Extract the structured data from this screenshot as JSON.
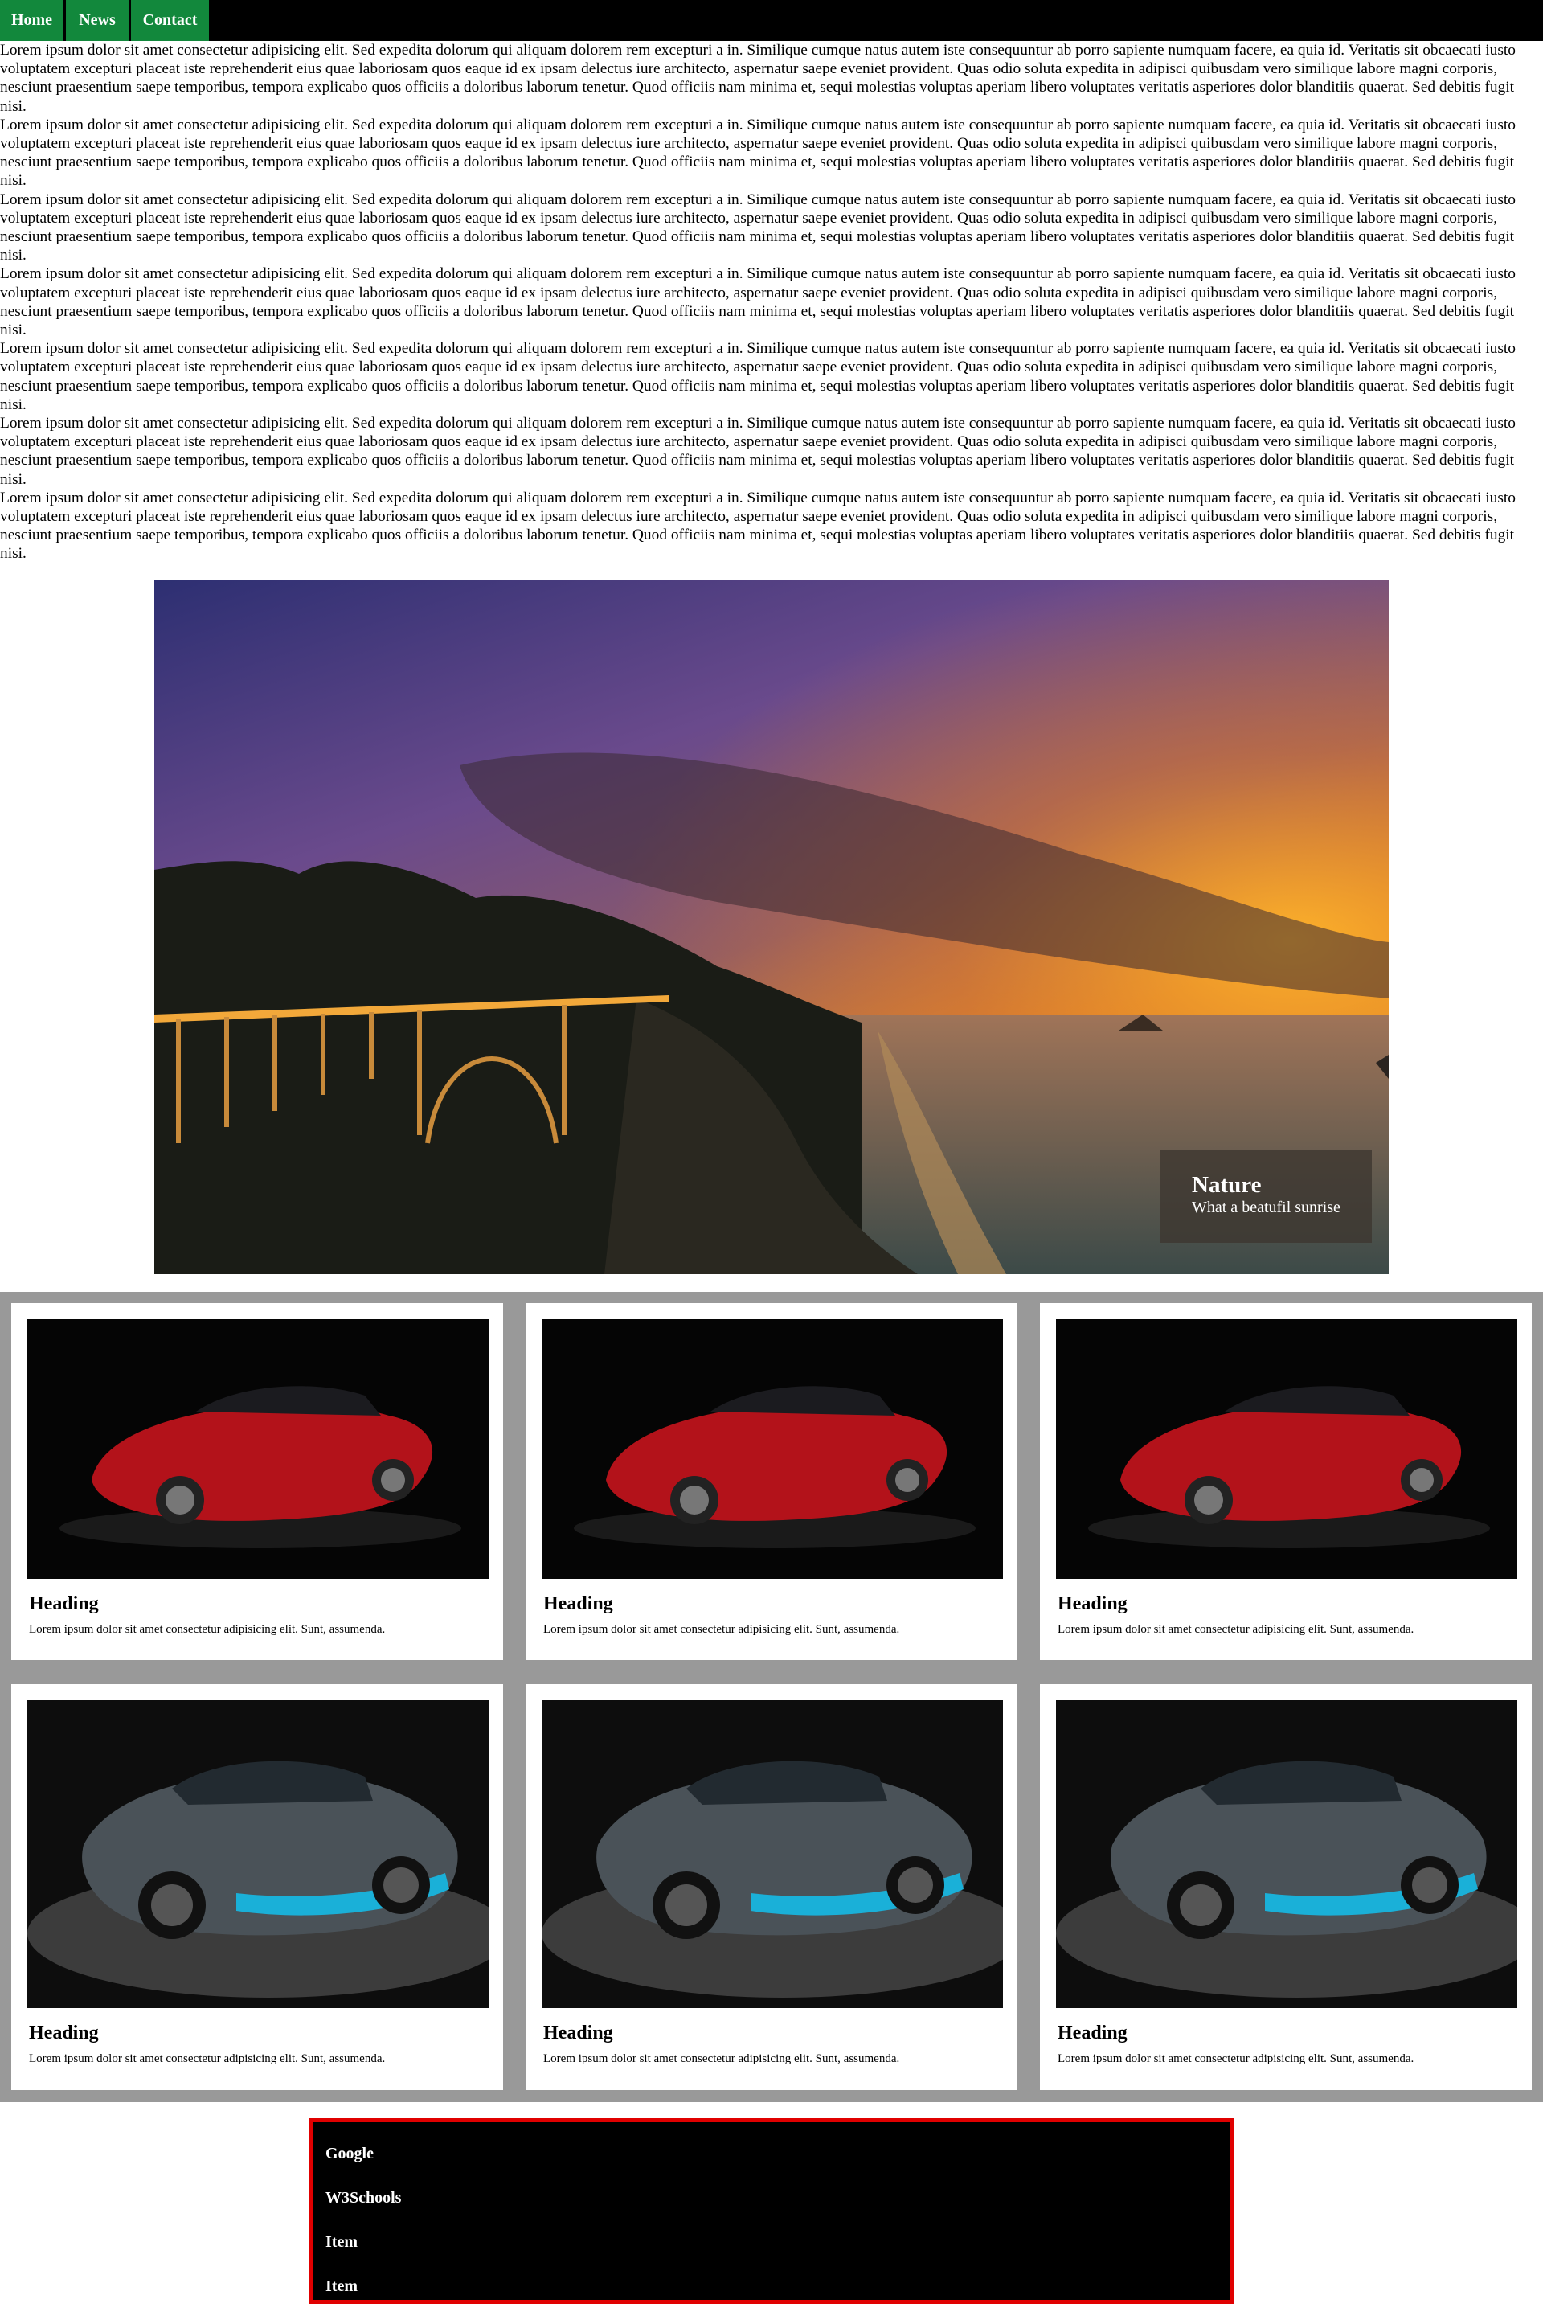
{
  "nav": {
    "items": [
      "Home",
      "News",
      "Contact"
    ],
    "background": "#000000",
    "item_color": "#12883c"
  },
  "lorem": {
    "paragraphs": [
      "Lorem ipsum dolor sit amet consectetur adipisicing elit. Sed expedita dolorum qui aliquam dolorem rem excepturi a in. Similique cumque natus autem iste consequuntur ab porro sapiente numquam facere, ea quia id. Veritatis sit obcaecati iusto voluptatem excepturi placeat iste reprehenderit eius quae laboriosam quos eaque id ex ipsam delectus iure architecto, aspernatur saepe eveniet provident. Quas odio soluta expedita in adipisci quibusdam vero similique labore magni corporis, nesciunt praesentium saepe temporibus, tempora explicabo quos officiis a doloribus laborum tenetur. Quod officiis nam minima et, sequi molestias voluptas aperiam libero voluptates veritatis asperiores dolor blanditiis quaerat. Sed debitis fugit nisi.",
      "Lorem ipsum dolor sit amet consectetur adipisicing elit. Sed expedita dolorum qui aliquam dolorem rem excepturi a in. Similique cumque natus autem iste consequuntur ab porro sapiente numquam facere, ea quia id. Veritatis sit obcaecati iusto voluptatem excepturi placeat iste reprehenderit eius quae laboriosam quos eaque id ex ipsam delectus iure architecto, aspernatur saepe eveniet provident. Quas odio soluta expedita in adipisci quibusdam vero similique labore magni corporis, nesciunt praesentium saepe temporibus, tempora explicabo quos officiis a doloribus laborum tenetur. Quod officiis nam minima et, sequi molestias voluptas aperiam libero voluptates veritatis asperiores dolor blanditiis quaerat. Sed debitis fugit nisi.",
      "Lorem ipsum dolor sit amet consectetur adipisicing elit. Sed expedita dolorum qui aliquam dolorem rem excepturi a in. Similique cumque natus autem iste consequuntur ab porro sapiente numquam facere, ea quia id. Veritatis sit obcaecati iusto voluptatem excepturi placeat iste reprehenderit eius quae laboriosam quos eaque id ex ipsam delectus iure architecto, aspernatur saepe eveniet provident. Quas odio soluta expedita in adipisci quibusdam vero similique labore magni corporis, nesciunt praesentium saepe temporibus, tempora explicabo quos officiis a doloribus laborum tenetur. Quod officiis nam minima et, sequi molestias voluptas aperiam libero voluptates veritatis asperiores dolor blanditiis quaerat. Sed debitis fugit nisi.",
      "Lorem ipsum dolor sit amet consectetur adipisicing elit. Sed expedita dolorum qui aliquam dolorem rem excepturi a in. Similique cumque natus autem iste consequuntur ab porro sapiente numquam facere, ea quia id. Veritatis sit obcaecati iusto voluptatem excepturi placeat iste reprehenderit eius quae laboriosam quos eaque id ex ipsam delectus iure architecto, aspernatur saepe eveniet provident. Quas odio soluta expedita in adipisci quibusdam vero similique labore magni corporis, nesciunt praesentium saepe temporibus, tempora explicabo quos officiis a doloribus laborum tenetur. Quod officiis nam minima et, sequi molestias voluptas aperiam libero voluptates veritatis asperiores dolor blanditiis quaerat. Sed debitis fugit nisi.",
      "Lorem ipsum dolor sit amet consectetur adipisicing elit. Sed expedita dolorum qui aliquam dolorem rem excepturi a in. Similique cumque natus autem iste consequuntur ab porro sapiente numquam facere, ea quia id. Veritatis sit obcaecati iusto voluptatem excepturi placeat iste reprehenderit eius quae laboriosam quos eaque id ex ipsam delectus iure architecto, aspernatur saepe eveniet provident. Quas odio soluta expedita in adipisci quibusdam vero similique labore magni corporis, nesciunt praesentium saepe temporibus, tempora explicabo quos officiis a doloribus laborum tenetur. Quod officiis nam minima et, sequi molestias voluptas aperiam libero voluptates veritatis asperiores dolor blanditiis quaerat. Sed debitis fugit nisi.",
      "Lorem ipsum dolor sit amet consectetur adipisicing elit. Sed expedita dolorum qui aliquam dolorem rem excepturi a in. Similique cumque natus autem iste consequuntur ab porro sapiente numquam facere, ea quia id. Veritatis sit obcaecati iusto voluptatem excepturi placeat iste reprehenderit eius quae laboriosam quos eaque id ex ipsam delectus iure architecto, aspernatur saepe eveniet provident. Quas odio soluta expedita in adipisci quibusdam vero similique labore magni corporis, nesciunt praesentium saepe temporibus, tempora explicabo quos officiis a doloribus laborum tenetur. Quod officiis nam minima et, sequi molestias voluptas aperiam libero voluptates veritatis asperiores dolor blanditiis quaerat. Sed debitis fugit nisi.",
      "Lorem ipsum dolor sit amet consectetur adipisicing elit. Sed expedita dolorum qui aliquam dolorem rem excepturi a in. Similique cumque natus autem iste consequuntur ab porro sapiente numquam facere, ea quia id. Veritatis sit obcaecati iusto voluptatem excepturi placeat iste reprehenderit eius quae laboriosam quos eaque id ex ipsam delectus iure architecto, aspernatur saepe eveniet provident. Quas odio soluta expedita in adipisci quibusdam vero similique labore magni corporis, nesciunt praesentium saepe temporibus, tempora explicabo quos officiis a doloribus laborum tenetur. Quod officiis nam minima et, sequi molestias voluptas aperiam libero voluptates veritatis asperiores dolor blanditiis quaerat. Sed debitis fugit nisi."
    ]
  },
  "hero": {
    "caption_title": "Nature",
    "caption_subtitle": "What a beatufil sunrise"
  },
  "cards": [
    {
      "heading": "Heading",
      "text": "Lorem ipsum dolor sit amet consectetur adipisicing elit. Sunt, assumenda."
    },
    {
      "heading": "Heading",
      "text": "Lorem ipsum dolor sit amet consectetur adipisicing elit. Sunt, assumenda."
    },
    {
      "heading": "Heading",
      "text": "Lorem ipsum dolor sit amet consectetur adipisicing elit. Sunt, assumenda."
    },
    {
      "heading": "Heading",
      "text": "Lorem ipsum dolor sit amet consectetur adipisicing elit. Sunt, assumenda."
    },
    {
      "heading": "Heading",
      "text": "Lorem ipsum dolor sit amet consectetur adipisicing elit. Sunt, assumenda."
    },
    {
      "heading": "Heading",
      "text": "Lorem ipsum dolor sit amet consectetur adipisicing elit. Sunt, assumenda."
    }
  ],
  "footer": {
    "links": [
      "Google",
      "W3Schools",
      "Item",
      "Item"
    ],
    "border_color": "#e00000"
  }
}
